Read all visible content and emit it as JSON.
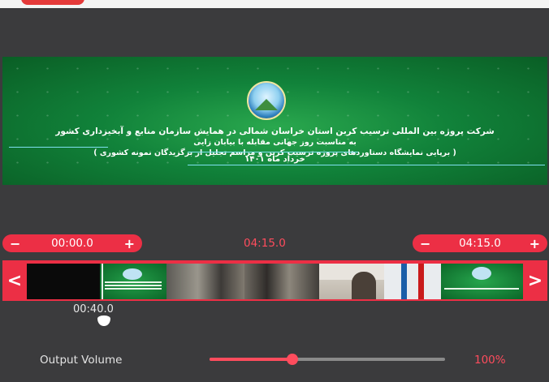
{
  "video": {
    "line1": "شرکت پروژه بین المللی ترسیب کربن استان خراسان شمالی در همایش سازمان منابع و آبخیزداری کشور",
    "line2": "به مناسبت روز جهانی مقابله با بیابان زایی",
    "line3": "( برپایی نمایشگاه دستاوردهای پروژه ترسیب کربن و مراسم تجلیل از برگزیدگان نمونه کشوری )",
    "date": "خرداد ماه ۱۴۰۱"
  },
  "trim": {
    "start": {
      "minus": "−",
      "value": "00:00.0",
      "plus": "+"
    },
    "duration": "04:15.0",
    "end": {
      "minus": "−",
      "value": "04:15.0",
      "plus": "+"
    }
  },
  "timeline": {
    "prev": "<",
    "next": ">",
    "cursor_time": "00:40.0"
  },
  "volume": {
    "label": "Output Volume",
    "value": "100%",
    "level": 0.35
  },
  "colors": {
    "accent": "#ec2f45",
    "background": "#3b3b3d"
  }
}
